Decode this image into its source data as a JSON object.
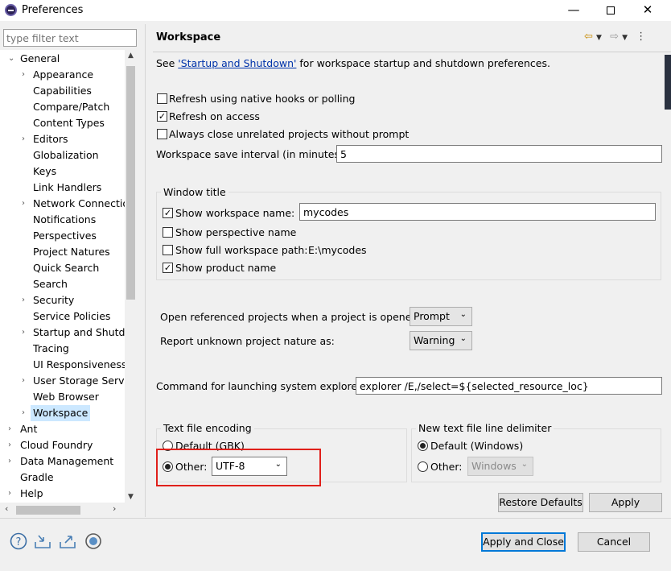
{
  "window": {
    "title": "Preferences",
    "minimize": "—",
    "close": "✕"
  },
  "filter": {
    "placeholder": "type filter text"
  },
  "tree": [
    {
      "label": "General",
      "arrow": "⌄",
      "level": 0
    },
    {
      "label": "Appearance",
      "arrow": "›",
      "level": 1
    },
    {
      "label": "Capabilities",
      "arrow": "",
      "level": 1
    },
    {
      "label": "Compare/Patch",
      "arrow": "",
      "level": 1
    },
    {
      "label": "Content Types",
      "arrow": "",
      "level": 1
    },
    {
      "label": "Editors",
      "arrow": "›",
      "level": 1
    },
    {
      "label": "Globalization",
      "arrow": "",
      "level": 1
    },
    {
      "label": "Keys",
      "arrow": "",
      "level": 1
    },
    {
      "label": "Link Handlers",
      "arrow": "",
      "level": 1
    },
    {
      "label": "Network Connectio",
      "arrow": "›",
      "level": 1
    },
    {
      "label": "Notifications",
      "arrow": "",
      "level": 1
    },
    {
      "label": "Perspectives",
      "arrow": "",
      "level": 1
    },
    {
      "label": "Project Natures",
      "arrow": "",
      "level": 1
    },
    {
      "label": "Quick Search",
      "arrow": "",
      "level": 1
    },
    {
      "label": "Search",
      "arrow": "",
      "level": 1
    },
    {
      "label": "Security",
      "arrow": "›",
      "level": 1
    },
    {
      "label": "Service Policies",
      "arrow": "",
      "level": 1
    },
    {
      "label": "Startup and Shutdo",
      "arrow": "›",
      "level": 1
    },
    {
      "label": "Tracing",
      "arrow": "",
      "level": 1
    },
    {
      "label": "UI Responsiveness",
      "arrow": "",
      "level": 1
    },
    {
      "label": "User Storage Servic",
      "arrow": "›",
      "level": 1
    },
    {
      "label": "Web Browser",
      "arrow": "",
      "level": 1
    },
    {
      "label": "Workspace",
      "arrow": "›",
      "level": 1,
      "selected": true
    },
    {
      "label": "Ant",
      "arrow": "›",
      "level": 0
    },
    {
      "label": "Cloud Foundry",
      "arrow": "›",
      "level": 0
    },
    {
      "label": "Data Management",
      "arrow": "›",
      "level": 0
    },
    {
      "label": "Gradle",
      "arrow": "",
      "level": 0
    },
    {
      "label": "Help",
      "arrow": "›",
      "level": 0
    }
  ],
  "panel": {
    "title": "Workspace",
    "see_prefix": "See ",
    "see_link": "'Startup and Shutdown'",
    "see_suffix": " for workspace startup and shutdown preferences.",
    "refresh_native": "Refresh using native hooks or polling",
    "refresh_access": "Refresh on access",
    "always_close": "Always close unrelated projects without prompt",
    "save_interval_label": "Workspace save interval (in minutes):",
    "save_interval_value": "5",
    "window_title_group": "Window title",
    "show_ws_name": "Show workspace name:",
    "ws_name_value": "mycodes",
    "show_perspective": "Show perspective name",
    "show_full_path": "Show full workspace path:",
    "full_path_value": "E:\\mycodes",
    "show_product": "Show product name",
    "open_ref_label": "Open referenced projects when a project is opened:",
    "open_ref_value": "Prompt",
    "report_unknown_label": "Report unknown project nature as:",
    "report_unknown_value": "Warning",
    "cmd_label": "Command for launching system explorer:",
    "cmd_value": "explorer /E,/select=${selected_resource_loc}",
    "encoding_group": "Text file encoding",
    "encoding_default": "Default (GBK)",
    "encoding_other": "Other:",
    "encoding_value": "UTF-8",
    "delimiter_group": "New text file line delimiter",
    "delimiter_default": "Default (Windows)",
    "delimiter_other": "Other:",
    "delimiter_value": "Windows",
    "restore_defaults": "Restore Defaults",
    "apply": "Apply"
  },
  "footer": {
    "apply_close": "Apply and Close",
    "cancel": "Cancel"
  },
  "colors": {
    "accent": "#0078d7",
    "highlight": "#e0201b",
    "selection": "#cce8ff"
  }
}
